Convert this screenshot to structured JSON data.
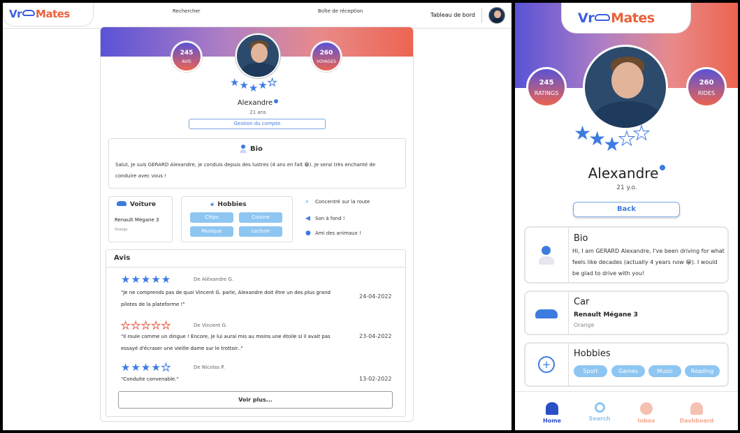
{
  "desktop": {
    "logo": {
      "part1": "Vr",
      "part2": "Mates"
    },
    "nav": {
      "search": "Rechercher",
      "inbox": "Boîte de réception",
      "dashboard": "Tableau de bord"
    },
    "profile": {
      "reviews_count": "245",
      "reviews_label": "AVIS",
      "trips_count": "260",
      "trips_label": "VOYAGES",
      "name": "Alexandre",
      "age": "21 ans",
      "account_button": "Gestion du compte",
      "rating": 4
    },
    "bio": {
      "title": "Bio",
      "text": "Salut, Je suis GERARD Alexandre, je conduis depuis des lustres (4 ans en fait 😁). Je serai très enchanté de conduire avec vous !"
    },
    "car": {
      "title": "Voiture",
      "model": "Renault Mégane 3",
      "color": "Orange"
    },
    "hobbies": {
      "title": "Hobbies",
      "items": [
        "Chips",
        "Cuisine",
        "Musique",
        "Lecture"
      ]
    },
    "traits": [
      "Concentré sur la route",
      "Son à fond !",
      "Ami des animaux !"
    ],
    "reviews": {
      "title": "Avis",
      "items": [
        {
          "rating": 5,
          "author": "De Alëxandre G.",
          "text": "\"Je ne comprends pas de quoi Vincent G. parle, Alexandre doit être un des plus grand pilotes de la plateforme !\"",
          "date": "24-04-2022"
        },
        {
          "rating": 0,
          "author": "De Vincent G.",
          "text": "\"Il roule comme un dingue ! Encore, je lui aurai mis au moins une étoile si il avait pas essayé d'écraser une vieille dame sur le trottoir..\"",
          "date": "23-04-2022"
        },
        {
          "rating": 4,
          "author": "De Nicolas P.",
          "text": "\"Conduite convenable.\"",
          "date": "13-02-2022"
        }
      ],
      "more_button": "Voir plus..."
    }
  },
  "mobile": {
    "logo": {
      "part1": "Vr",
      "part2": "Mates"
    },
    "reviews_count": "245",
    "reviews_label": "RATINGS",
    "trips_count": "260",
    "trips_label": "RIDES",
    "rating": 3,
    "name": "Alexandre",
    "age": "21 y.o.",
    "back_button": "Back",
    "bio": {
      "title": "Bio",
      "text": "Hi, I am GERARD Alexandre, I've been driving for what feels like decades (actually 4 years now 😁). I would be glad to drive with you!"
    },
    "car": {
      "title": "Car",
      "model": "Renault Mégane 3",
      "color": "Orange"
    },
    "hobbies": {
      "title": "Hobbies",
      "items": [
        "Sport",
        "Games",
        "Music",
        "Reading"
      ]
    },
    "tabs": [
      {
        "label": "Home",
        "color": "#2b4fc7"
      },
      {
        "label": "Search",
        "color": "#8ec6f2"
      },
      {
        "label": "Inbox",
        "color": "#f5a98f"
      },
      {
        "label": "Dashboard",
        "color": "#f5a98f"
      }
    ]
  },
  "colors": {
    "brand_blue": "#3d5fe0",
    "brand_orange": "#e8613c",
    "star": "#3d7be0",
    "chip": "#8ec6f2"
  }
}
